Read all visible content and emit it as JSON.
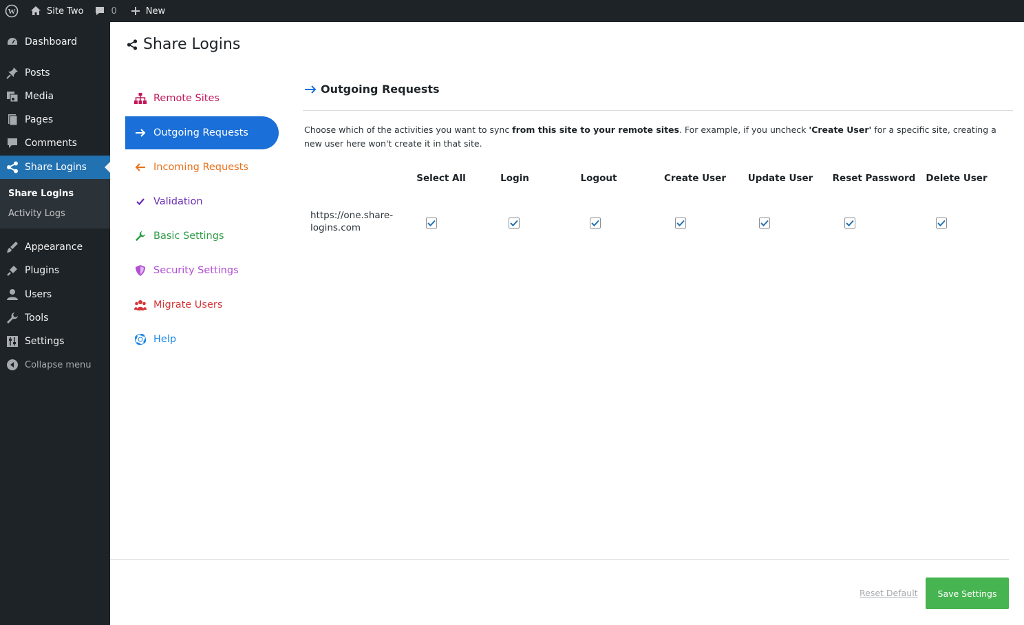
{
  "adminbar": {
    "site_name": "Site Two",
    "comments_count": "0",
    "new_label": "New"
  },
  "sidebar": {
    "items": [
      {
        "label": "Dashboard",
        "icon": "dashboard-icon"
      },
      {
        "label": "Posts",
        "icon": "pin-icon"
      },
      {
        "label": "Media",
        "icon": "media-icon"
      },
      {
        "label": "Pages",
        "icon": "pages-icon"
      },
      {
        "label": "Comments",
        "icon": "comment-icon"
      },
      {
        "label": "Share Logins",
        "icon": "share-icon"
      },
      {
        "label": "Appearance",
        "icon": "brush-icon"
      },
      {
        "label": "Plugins",
        "icon": "plug-icon"
      },
      {
        "label": "Users",
        "icon": "user-icon"
      },
      {
        "label": "Tools",
        "icon": "wrench-icon"
      },
      {
        "label": "Settings",
        "icon": "sliders-icon"
      }
    ],
    "submenu": [
      "Share Logins",
      "Activity Logs"
    ],
    "collapse_label": "Collapse menu"
  },
  "page": {
    "title": "Share Logins"
  },
  "nav": {
    "items": [
      {
        "label": "Remote Sites",
        "color": "#c2185b",
        "icon": "sitemap-icon"
      },
      {
        "label": "Outgoing Requests",
        "color": "#ffffff",
        "icon": "arrow-right-icon"
      },
      {
        "label": "Incoming Requests",
        "color": "#e8701a",
        "icon": "arrow-left-icon"
      },
      {
        "label": "Validation",
        "color": "#6a2cb5",
        "icon": "check-icon"
      },
      {
        "label": "Basic Settings",
        "color": "#2e9d46",
        "icon": "wrench-icon"
      },
      {
        "label": "Security Settings",
        "color": "#b14fd3",
        "icon": "shield-icon"
      },
      {
        "label": "Migrate Users",
        "color": "#d63638",
        "icon": "users-icon"
      },
      {
        "label": "Help",
        "color": "#1e88e5",
        "icon": "lifebuoy-icon"
      }
    ],
    "active_color": "#1a6fd8"
  },
  "section": {
    "title": "Outgoing Requests",
    "desc_1": "Choose which of the activities you want to sync ",
    "desc_bold_1": "from this site to your remote sites",
    "desc_2": ". For example, if you uncheck ",
    "desc_bold_2": "'Create User'",
    "desc_3": " for a specific site, creating a new user here won't create it in that site.",
    "columns": [
      "Select All",
      "Login",
      "Logout",
      "Create User",
      "Update User",
      "Reset Password",
      "Delete User"
    ],
    "rows": [
      {
        "url": "https://one.share-logins.com",
        "checked": [
          true,
          true,
          true,
          true,
          true,
          true,
          true
        ]
      }
    ]
  },
  "footer": {
    "reset_label": "Reset Default",
    "save_label": "Save Settings",
    "save_color": "#46b450"
  }
}
